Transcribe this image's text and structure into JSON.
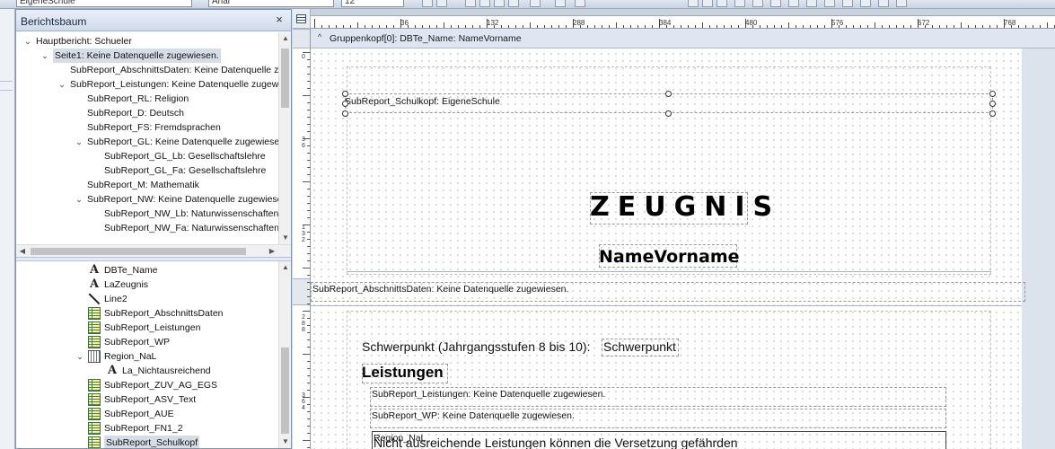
{
  "toolbar": {
    "field1": "EigeneSchule",
    "field2": "Arial",
    "field3": "12"
  },
  "panel": {
    "title": "Berichtsbaum",
    "close_glyph": "×"
  },
  "tree": [
    {
      "label": "Hauptbericht: Schueler",
      "twisty": "⌄",
      "level": 0
    },
    {
      "label": "Seite1: Keine Datenquelle zugewiesen.",
      "twisty": "⌄",
      "level": 1,
      "selected": true
    },
    {
      "label": "SubReport_AbschnittsDaten: Keine Datenquelle zugewiesen.",
      "twisty": "",
      "level": 2
    },
    {
      "label": "SubReport_Leistungen: Keine Datenquelle zugewiesen.",
      "twisty": "⌄",
      "level": 2
    },
    {
      "label": "SubReport_RL: Religion",
      "twisty": "",
      "level": 3
    },
    {
      "label": "SubReport_D: Deutsch",
      "twisty": "",
      "level": 3
    },
    {
      "label": "SubReport_FS: Fremdsprachen",
      "twisty": "",
      "level": 3
    },
    {
      "label": "SubReport_GL: Keine Datenquelle zugewiesen.",
      "twisty": "⌄",
      "level": 3
    },
    {
      "label": "SubReport_GL_Lb: Gesellschaftslehre",
      "twisty": "",
      "level": 4
    },
    {
      "label": "SubReport_GL_Fa: Gesellschaftslehre",
      "twisty": "",
      "level": 4
    },
    {
      "label": "SubReport_M: Mathematik",
      "twisty": "",
      "level": 3
    },
    {
      "label": "SubReport_NW: Keine Datenquelle zugewiesen.",
      "twisty": "⌄",
      "level": 3
    },
    {
      "label": "SubReport_NW_Lb: Naturwissenschaften",
      "twisty": "",
      "level": 4
    },
    {
      "label": "SubReport_NW_Fa: Naturwissenschaften",
      "twisty": "",
      "level": 4
    }
  ],
  "components": [
    {
      "label": "DBTe_Name",
      "icon": "text-icon",
      "indent": 0
    },
    {
      "label": "LaZeugnis",
      "icon": "text-icon",
      "indent": 0
    },
    {
      "label": "Line2",
      "icon": "line-icon",
      "indent": 0
    },
    {
      "label": "SubReport_AbschnittsDaten",
      "icon": "subreport-icon",
      "indent": 0
    },
    {
      "label": "SubReport_Leistungen",
      "icon": "subreport-icon",
      "indent": 0
    },
    {
      "label": "SubReport_WP",
      "icon": "subreport-icon",
      "indent": 0
    },
    {
      "label": "Region_NaL",
      "icon": "region-icon",
      "indent": 0,
      "twisty": "⌄"
    },
    {
      "label": "La_Nichtausreichend",
      "icon": "text-icon",
      "indent": 1
    },
    {
      "label": "SubReport_ZUV_AG_EGS",
      "icon": "subreport-icon",
      "indent": 0
    },
    {
      "label": "SubReport_ASV_Text",
      "icon": "subreport-icon",
      "indent": 0
    },
    {
      "label": "SubReport_AUE",
      "icon": "subreport-icon",
      "indent": 0
    },
    {
      "label": "SubReport_FN1_2",
      "icon": "subreport-icon",
      "indent": 0
    },
    {
      "label": "SubReport_Schulkopf",
      "icon": "subreport-icon",
      "indent": 0,
      "selected": true
    }
  ],
  "ruler": {
    "h_labels": [
      "36",
      "132",
      "288",
      "384",
      "480",
      "576",
      "672",
      "768"
    ],
    "v_labels": [
      "0",
      "36",
      "132",
      "288",
      "364"
    ]
  },
  "designer": {
    "group_header": "Gruppenkopf[0]: DBTe_Name: NameVorname",
    "schulkopf": "SubReport_Schulkopf: EigeneSchule",
    "title": "ZEUGNIS",
    "name_field": "NameVorname",
    "abschnitts": "SubReport_AbschnittsDaten: Keine Datenquelle zugewiesen.",
    "schwerpunkt_label": "Schwerpunkt (Jahrgangsstufen 8 bis 10):",
    "schwerpunkt_value": "Schwerpunkt",
    "leistungen_heading": "Leistungen",
    "leistungen_sub": "SubReport_Leistungen: Keine Datenquelle zugewiesen.",
    "wp_sub": "SubReport_WP: Keine Datenquelle zugewiesen.",
    "region": "Region_NaL",
    "nicht_text": "Nicht ausreichende Leistungen können die Versetzung gefährden"
  }
}
